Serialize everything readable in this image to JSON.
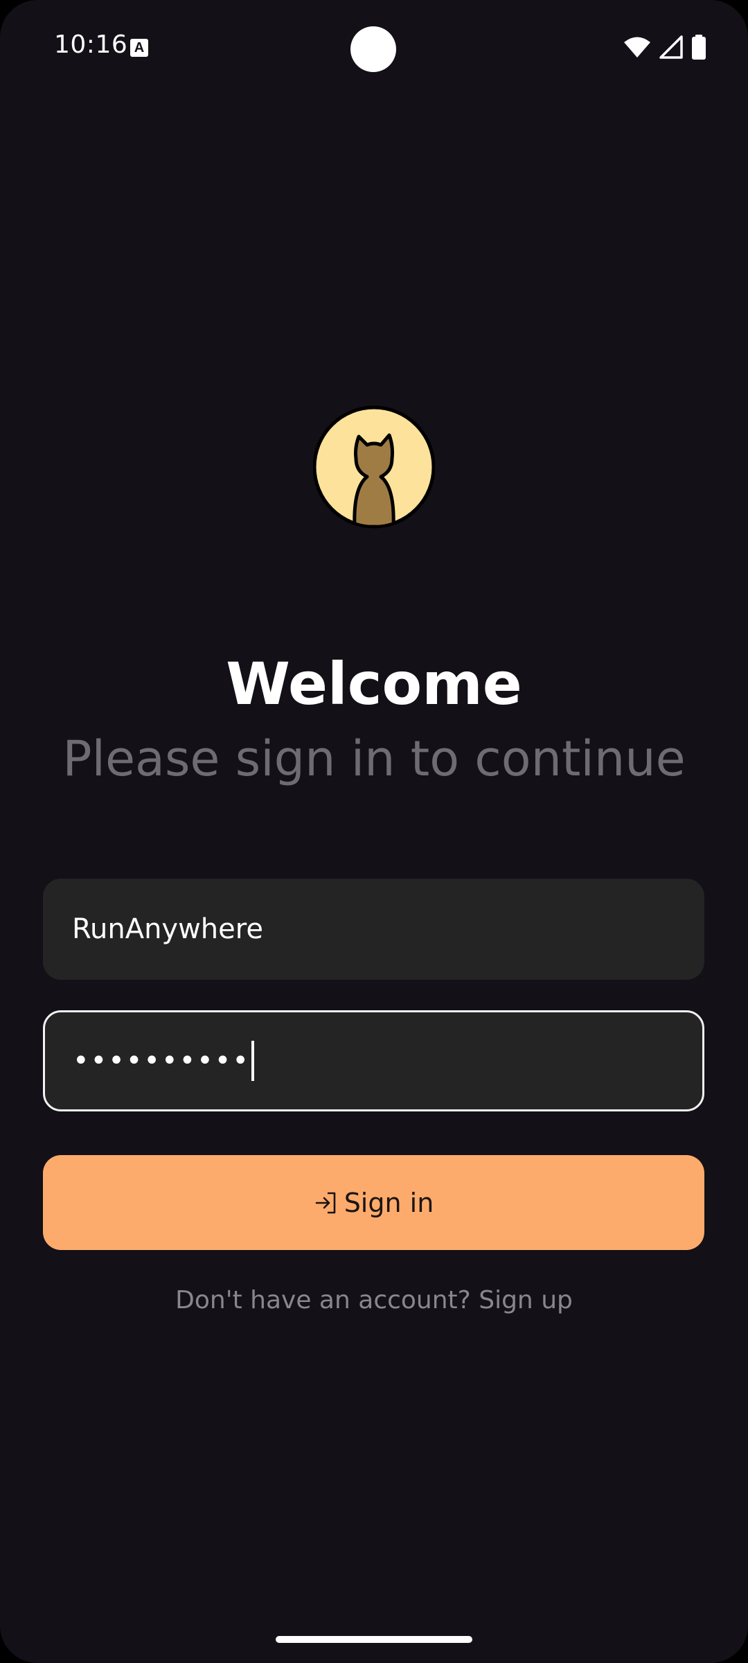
{
  "status_bar": {
    "time": "10:16",
    "notification_icon_letter": "A",
    "icons": [
      "wifi-icon",
      "signal-icon",
      "battery-icon"
    ]
  },
  "logo": {
    "icon": "cat-avatar-icon",
    "accent": "#fde29b"
  },
  "header": {
    "title": "Welcome",
    "subtitle": "Please sign in to continue"
  },
  "form": {
    "username_value": "RunAnywhere",
    "password_value": "••••••••••",
    "password_focused": true,
    "signin_label": "Sign in",
    "signin_icon": "login-icon",
    "signup_prompt": "Don't have an account? Sign up"
  },
  "colors": {
    "background": "#131017",
    "field_background": "#242424",
    "primary_button": "#fdab6c",
    "subtitle_text": "#6f6b74"
  }
}
